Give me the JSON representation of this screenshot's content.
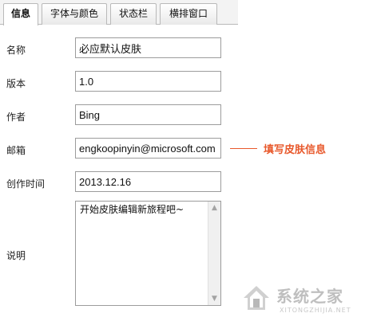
{
  "tabs": [
    {
      "label": "信息",
      "active": true
    },
    {
      "label": "字体与颜色"
    },
    {
      "label": "状态栏"
    },
    {
      "label": "横排窗口"
    }
  ],
  "form": {
    "name_label": "名称",
    "name_value": "必应默认皮肤",
    "version_label": "版本",
    "version_value": "1.0",
    "author_label": "作者",
    "author_value": "Bing",
    "email_label": "邮箱",
    "email_value": "engkoopinyin@microsoft.com",
    "created_label": "创作时间",
    "created_value": "2013.12.16",
    "desc_label": "说明",
    "desc_value": "开始皮肤编辑新旅程吧~"
  },
  "callout": {
    "text": "填写皮肤信息",
    "color": "#e8582b"
  },
  "watermark": {
    "title": "系统之家",
    "subtitle": "XITONGZHIJIA.NET"
  },
  "icons": {
    "scroll_up": "triangle-up-icon",
    "scroll_down": "triangle-down-icon",
    "watermark_logo": "house-logo-icon"
  }
}
